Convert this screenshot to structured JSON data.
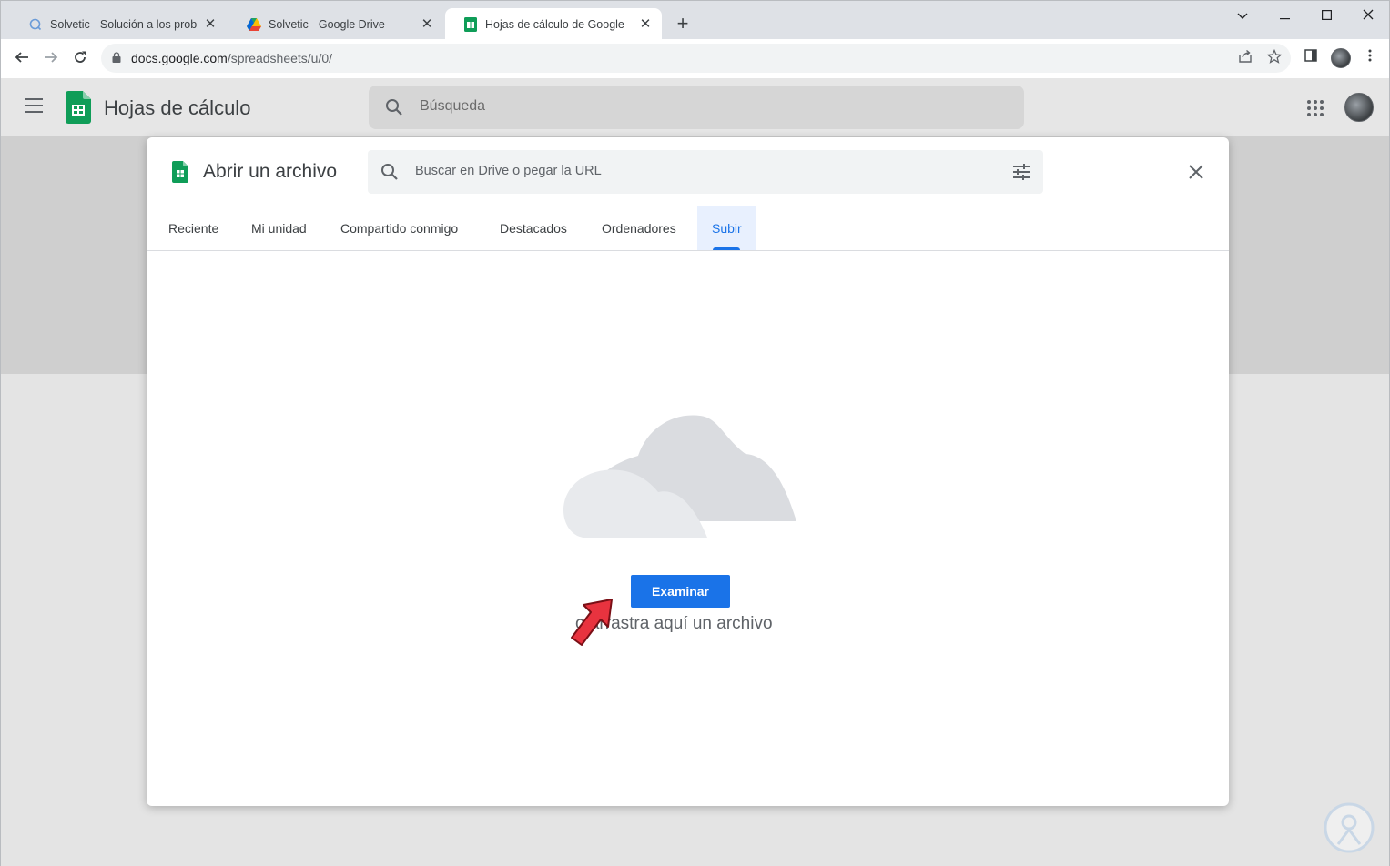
{
  "browser": {
    "tabs": [
      {
        "title": "Solvetic - Solución a los problem",
        "icon": "solvetic-icon"
      },
      {
        "title": "Solvetic - Google Drive",
        "icon": "google-drive-icon"
      },
      {
        "title": "Hojas de cálculo de Google",
        "icon": "google-sheets-icon",
        "active": true
      }
    ],
    "new_tab_label": "+",
    "url_host": "docs.google.com",
    "url_path": "/spreadsheets/u/0/"
  },
  "app": {
    "title": "Hojas de cálculo",
    "search_placeholder": "Búsqueda"
  },
  "dialog": {
    "title": "Abrir un archivo",
    "search_placeholder": "Buscar en Drive o pegar la URL",
    "tabs": [
      "Reciente",
      "Mi unidad",
      "Compartido conmigo",
      "Destacados",
      "Ordenadores",
      "Subir"
    ],
    "active_tab": "Subir",
    "browse_button": "Examinar",
    "drag_text": "o arrastra aquí un archivo"
  },
  "colors": {
    "accent": "#1a73e8",
    "sheets_green": "#0f9d58",
    "arrow_red": "#e8333f"
  }
}
